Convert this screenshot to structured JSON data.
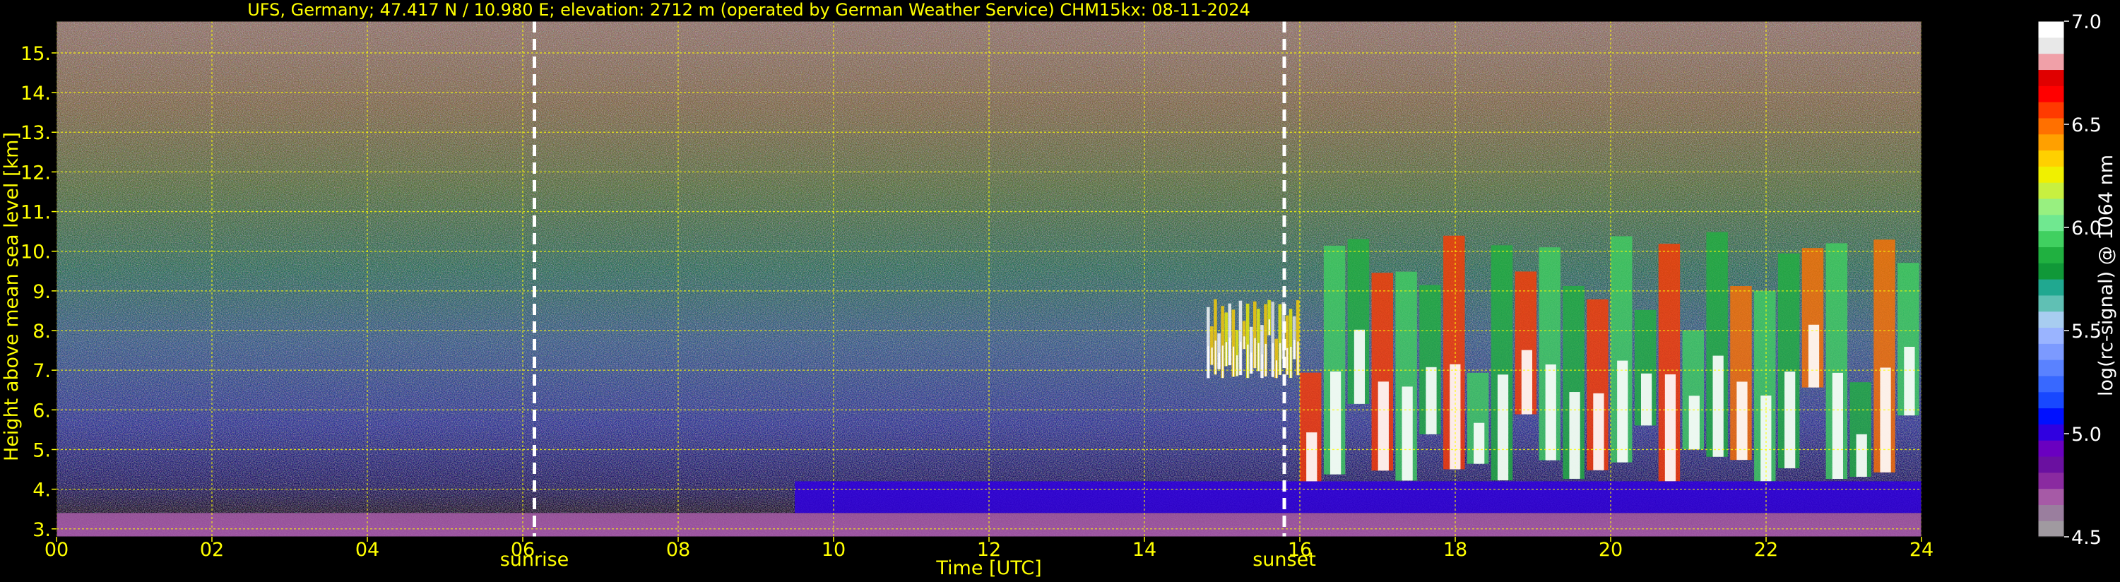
{
  "chart_data": {
    "type": "heatmap",
    "title": "UFS, Germany; 47.417 N / 10.980 E; elevation: 2712 m  (operated by German Weather Service)    CHM15kx: 08-11-2024",
    "xlabel": "Time [UTC]",
    "ylabel": "Height above mean sea level [km]",
    "colorbar_label": "log(rc-signal) @ 1064 nm",
    "xlim": [
      0,
      24
    ],
    "ylim": [
      2.8,
      15.8
    ],
    "x_ticks": [
      0,
      2,
      4,
      6,
      8,
      10,
      12,
      14,
      16,
      18,
      20,
      22,
      24
    ],
    "x_tick_labels": [
      "00",
      "02",
      "04",
      "06",
      "08",
      "10",
      "12",
      "14",
      "16",
      "18",
      "20",
      "22",
      "24"
    ],
    "y_ticks": [
      3,
      4,
      5,
      6,
      7,
      8,
      9,
      10,
      11,
      12,
      13,
      14,
      15
    ],
    "y_tick_labels": [
      "3.",
      "4.",
      "5.",
      "6.",
      "7.",
      "8.",
      "9.",
      "10.",
      "11.",
      "12.",
      "13.",
      "14.",
      "15."
    ],
    "grid": true,
    "markers": [
      {
        "name": "sunrise",
        "x": 6.15
      },
      {
        "name": "sunset",
        "x": 15.8
      }
    ],
    "colorbar": {
      "range": [
        4.5,
        7.0
      ],
      "ticks": [
        4.5,
        5.0,
        5.5,
        6.0,
        6.5,
        7.0
      ],
      "tick_labels": [
        "4.5",
        "5.0",
        "5.5",
        "6.0",
        "6.5",
        "7.0"
      ],
      "colors": [
        "#a09aa0",
        "#9a7e9e",
        "#a65aa6",
        "#8a2aa0",
        "#6a10a0",
        "#6a00c0",
        "#3000e0",
        "#0010ff",
        "#1848ff",
        "#3868ff",
        "#5a82ff",
        "#7c9aff",
        "#9ab4ff",
        "#a8cdf0",
        "#60c0b4",
        "#20a890",
        "#109838",
        "#20b040",
        "#40d060",
        "#70e890",
        "#98f080",
        "#c8f040",
        "#f0f000",
        "#ffd000",
        "#ffa000",
        "#ff7000",
        "#ff3a00",
        "#ff0000",
        "#e00000",
        "#f0a0a8",
        "#e8e8e8",
        "#ffffff"
      ]
    },
    "signal_features": [
      {
        "label": "surface layer",
        "x_range": [
          0,
          24
        ],
        "y_range": [
          2.8,
          3.4
        ],
        "level": 4.7
      },
      {
        "label": "boundary layer",
        "x_range": [
          9.5,
          24
        ],
        "y_range": [
          3.4,
          4.2
        ],
        "level": 5.0
      },
      {
        "label": "cloud",
        "x_range": [
          14.8,
          16.0
        ],
        "y_range": [
          6.8,
          8.8
        ],
        "level": 7.0
      },
      {
        "label": "cloud",
        "x_range": [
          16.0,
          24
        ],
        "y_range": [
          4.2,
          10.5
        ],
        "level": 6.6
      }
    ]
  }
}
